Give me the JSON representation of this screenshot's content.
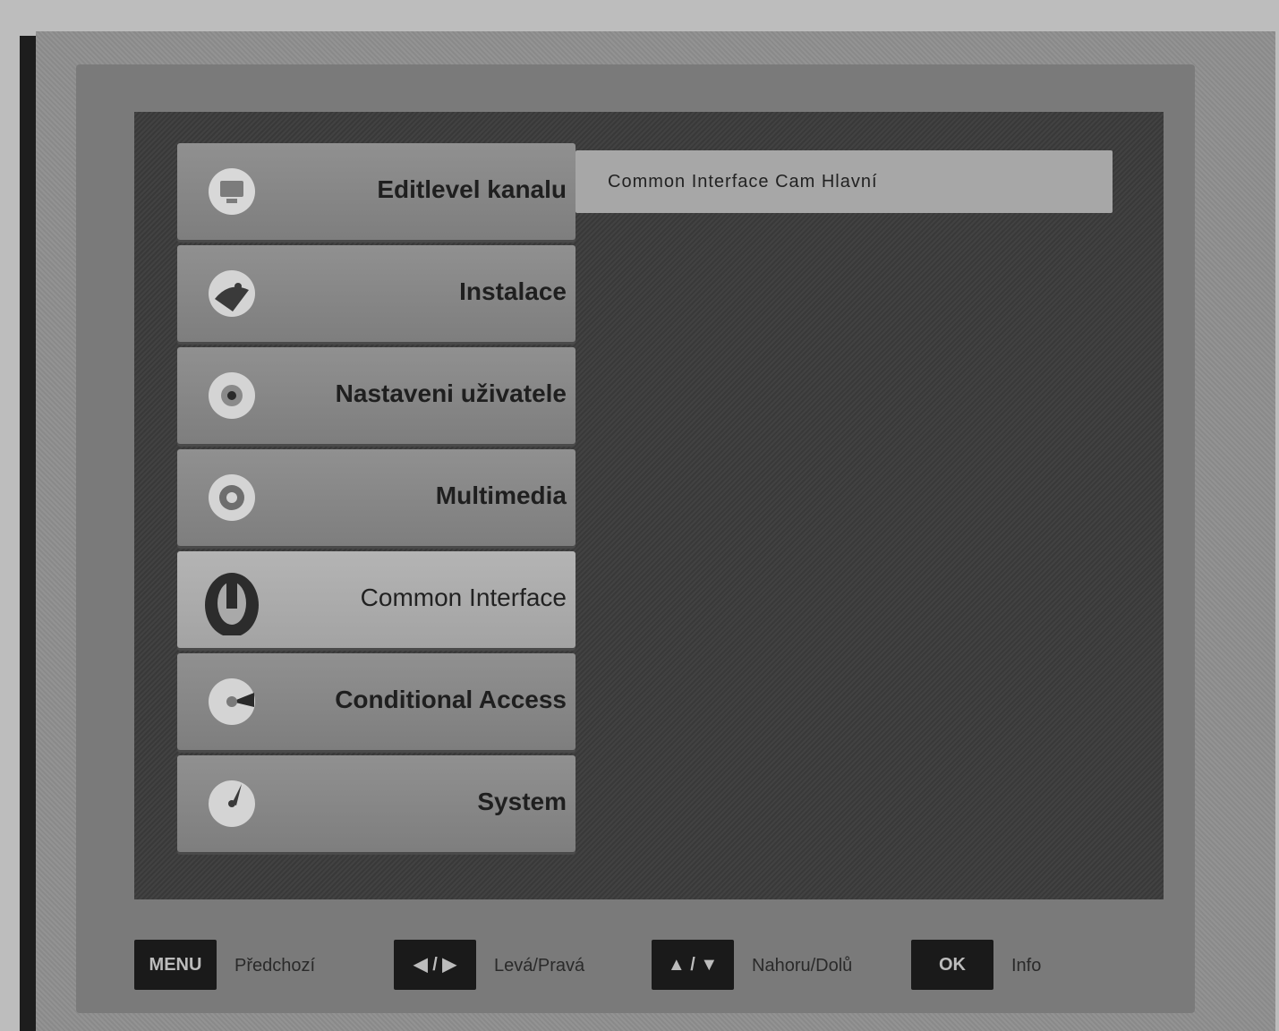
{
  "menu": {
    "items": [
      {
        "label": "Editlevel kanalu",
        "icon": "tv-icon",
        "selected": false
      },
      {
        "label": "Instalace",
        "icon": "satellite-dish-icon",
        "selected": false
      },
      {
        "label": "Nastaveni uživatele",
        "icon": "user-settings-icon",
        "selected": false
      },
      {
        "label": "Multimedia",
        "icon": "multimedia-icon",
        "selected": false
      },
      {
        "label": "Common Interface",
        "icon": "common-interface-icon",
        "selected": true
      },
      {
        "label": "Conditional Access",
        "icon": "conditional-access-icon",
        "selected": false
      },
      {
        "label": "System",
        "icon": "system-icon",
        "selected": false
      }
    ]
  },
  "submenu": {
    "label": "Common Interface Cam Hlavní"
  },
  "footer": {
    "hints": [
      {
        "key": "MENU",
        "label": "Předchozí"
      },
      {
        "key": "◀ / ▶",
        "label": "Levá/Pravá"
      },
      {
        "key": "▲ / ▼",
        "label": "Nahoru/Dolů"
      },
      {
        "key": "OK",
        "label": "Info"
      }
    ]
  },
  "colors": {
    "menu_background": "#3c3c3c",
    "item_background": "#878787",
    "item_selected": "#aaaaaa",
    "key_background": "#1a1a1a"
  }
}
